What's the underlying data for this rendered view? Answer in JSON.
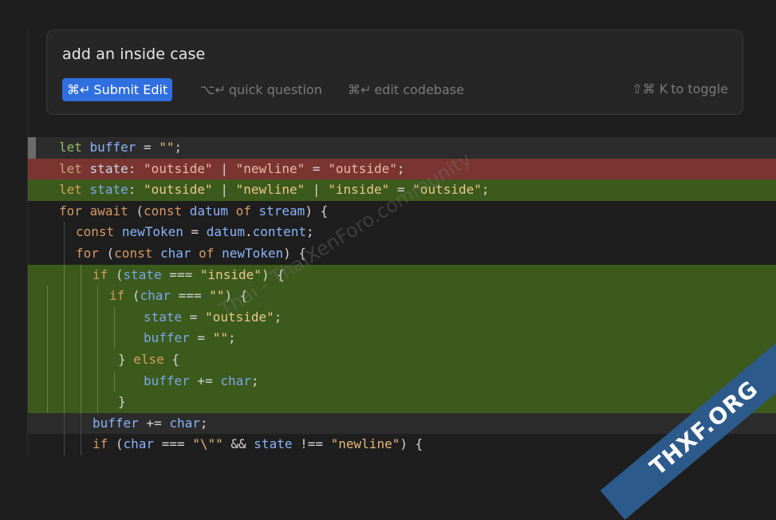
{
  "prompt": {
    "input_value": "add an inside case",
    "submit": {
      "keys": "⌘↵",
      "label": "Submit Edit"
    },
    "quick_question": {
      "keys": "⌥↵",
      "label": "quick question"
    },
    "edit_codebase": {
      "keys": "⌘↵",
      "label": "edit codebase"
    },
    "toggle": {
      "keys": "⇧⌘ K",
      "label": "to toggle"
    }
  },
  "watermark": "Thai - ThaiXenForo.community",
  "corner_badge": "THXF.ORG",
  "colors": {
    "added_bg": "#3c5a1c",
    "removed_bg": "#7a3530",
    "accent": "#2f6fe0"
  }
}
